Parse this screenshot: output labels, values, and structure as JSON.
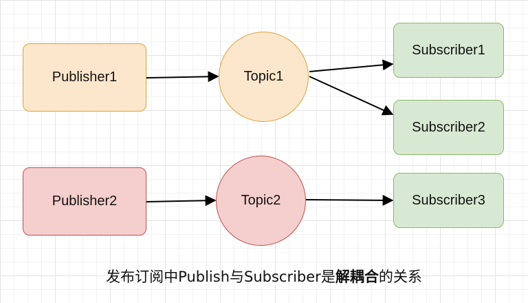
{
  "nodes": {
    "publisher1": "Publisher1",
    "publisher2": "Publisher2",
    "topic1": "Topic1",
    "topic2": "Topic2",
    "subscriber1": "Subscriber1",
    "subscriber2": "Subscriber2",
    "subscriber3": "Subscriber3"
  },
  "caption": {
    "before": "发布订阅中Publish与Subscriber是",
    "bold": "解耦合",
    "after": "的关系"
  },
  "edges": [
    {
      "from": "Publisher1",
      "to": "Topic1"
    },
    {
      "from": "Topic1",
      "to": "Subscriber1"
    },
    {
      "from": "Topic1",
      "to": "Subscriber2"
    },
    {
      "from": "Publisher2",
      "to": "Topic2"
    },
    {
      "from": "Topic2",
      "to": "Subscriber3"
    }
  ],
  "colors": {
    "publisher1": "#fde7cc",
    "topic1": "#fde7cc",
    "publisher2": "#f5cfcd",
    "topic2": "#f5cfcd",
    "subscriber": "#d8e9d3"
  }
}
